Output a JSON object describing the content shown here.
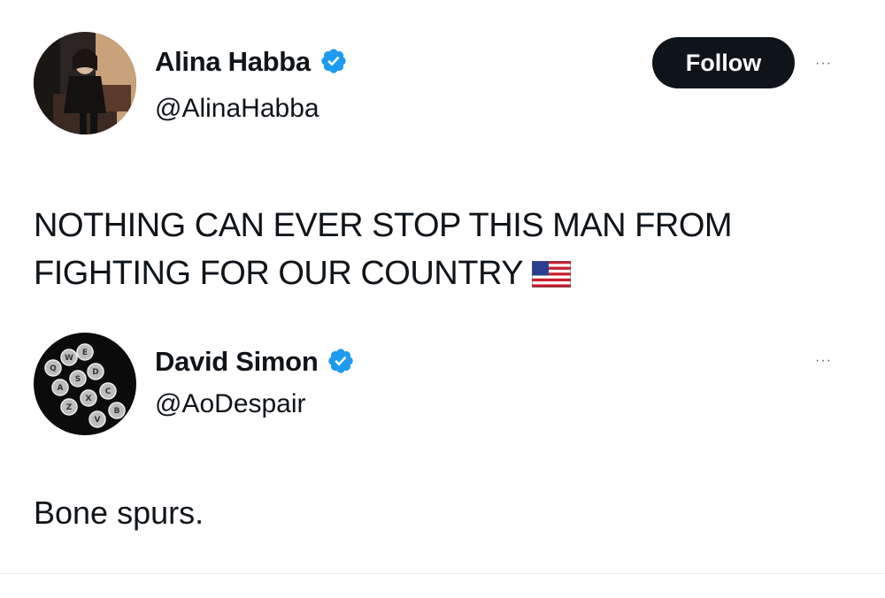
{
  "tweet": {
    "author": {
      "display_name": "Alina Habba",
      "handle": "@AlinaHabba",
      "verified": true,
      "verified_icon": "verified-badge-icon",
      "avatar_icon": "profile-photo"
    },
    "follow_label": "Follow",
    "more_label": "···",
    "text_line_1": "NOTHING CAN EVER STOP THIS MAN FROM",
    "text_line_2": "FIGHTING FOR OUR COUNTRY",
    "emoji": "us-flag-icon"
  },
  "reply": {
    "author": {
      "display_name": "David Simon",
      "handle": "@AoDespair",
      "verified": true,
      "verified_icon": "verified-badge-icon",
      "avatar_icon": "typewriter-keys-photo"
    },
    "more_label": "···",
    "text": "Bone spurs."
  },
  "colors": {
    "verified_blue": "#1d9bf0",
    "follow_bg": "#0f1419",
    "text": "#0f1419",
    "muted": "#536471"
  }
}
